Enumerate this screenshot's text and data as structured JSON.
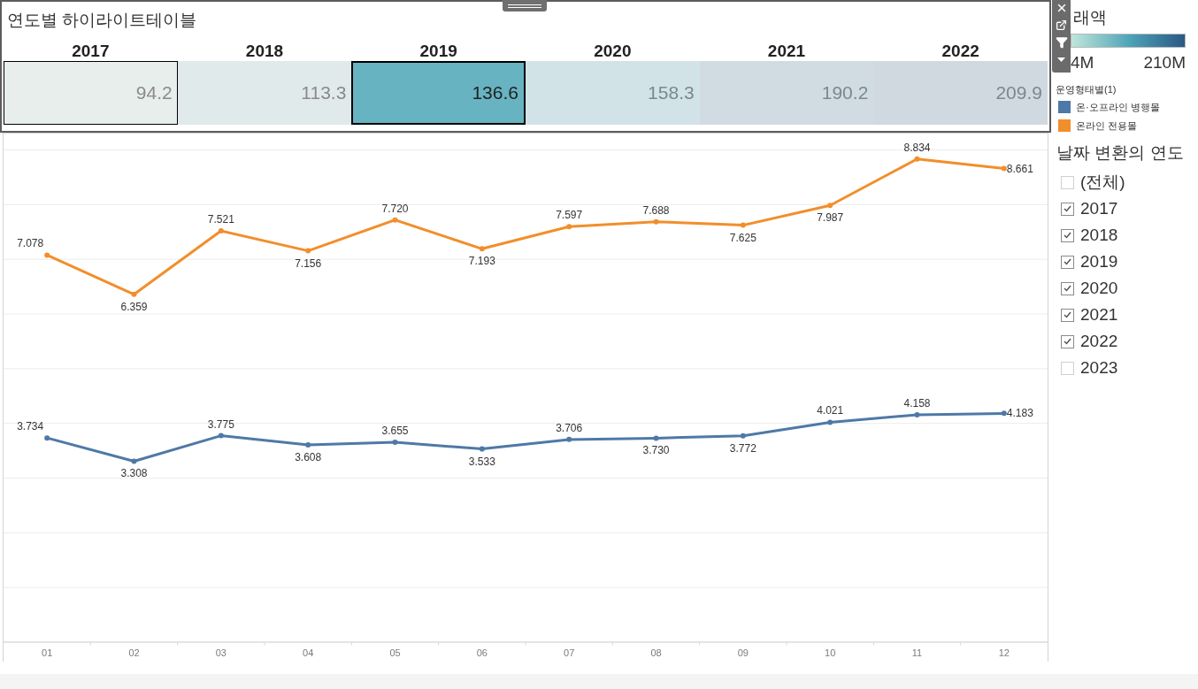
{
  "highlight_table": {
    "title": "연도별 하이라이트테이블",
    "cells": [
      {
        "year": "2017",
        "value": "94.2",
        "color": "#e8eeec",
        "selected": false,
        "hovered": true
      },
      {
        "year": "2018",
        "value": "113.3",
        "color": "#e1eaeb",
        "selected": false,
        "hovered": false
      },
      {
        "year": "2019",
        "value": "136.6",
        "color": "#67b3c2",
        "selected": true,
        "hovered": false
      },
      {
        "year": "2020",
        "value": "158.3",
        "color": "#d2e3e7",
        "selected": false,
        "hovered": false
      },
      {
        "year": "2021",
        "value": "190.2",
        "color": "#d1dce2",
        "selected": false,
        "hovered": false
      },
      {
        "year": "2022",
        "value": "209.9",
        "color": "#d1d9e0",
        "selected": false,
        "hovered": false
      }
    ]
  },
  "line_chart": {
    "chart_data": {
      "type": "line",
      "categories": [
        "01",
        "02",
        "03",
        "04",
        "05",
        "06",
        "07",
        "08",
        "09",
        "10",
        "11",
        "12"
      ],
      "ylim": [
        0,
        9.3
      ],
      "series": [
        {
          "name": "온·오프라인 병행몰",
          "color": "#4e79a7",
          "marker": "circle",
          "values": [
            3.734,
            3.308,
            3.775,
            3.608,
            3.655,
            3.533,
            3.706,
            3.73,
            3.772,
            4.021,
            4.158,
            4.183
          ],
          "value_labels": [
            "3.734",
            "3.308",
            "3.775",
            "3.608",
            "3.655",
            "3.533",
            "3.706",
            "3.730",
            "3.772",
            "4.021",
            "4.158",
            "4.183"
          ]
        },
        {
          "name": "온라인 전용몰",
          "color": "#f28e2b",
          "marker": "circle",
          "values": [
            7.078,
            6.359,
            7.521,
            7.156,
            7.72,
            7.193,
            7.597,
            7.688,
            7.625,
            7.987,
            8.834,
            8.661
          ],
          "value_labels": [
            "7.078",
            "6.359",
            "7.521",
            "7.156",
            "7.720",
            "7.193",
            "7.597",
            "7.688",
            "7.625",
            "7.987",
            "8.834",
            "8.661"
          ]
        }
      ]
    }
  },
  "sidebar": {
    "color_legend": {
      "title": "래액",
      "min_label": "4M",
      "max_label": "210M"
    },
    "series_legend": {
      "title": "운영형태별(1)"
    },
    "year_filter": {
      "title": "날짜 변환의 연도",
      "options": [
        {
          "label": "(전체)",
          "checked": false
        },
        {
          "label": "2017",
          "checked": true
        },
        {
          "label": "2018",
          "checked": true
        },
        {
          "label": "2019",
          "checked": true
        },
        {
          "label": "2020",
          "checked": true
        },
        {
          "label": "2021",
          "checked": true
        },
        {
          "label": "2022",
          "checked": true
        },
        {
          "label": "2023",
          "checked": false
        }
      ]
    }
  }
}
